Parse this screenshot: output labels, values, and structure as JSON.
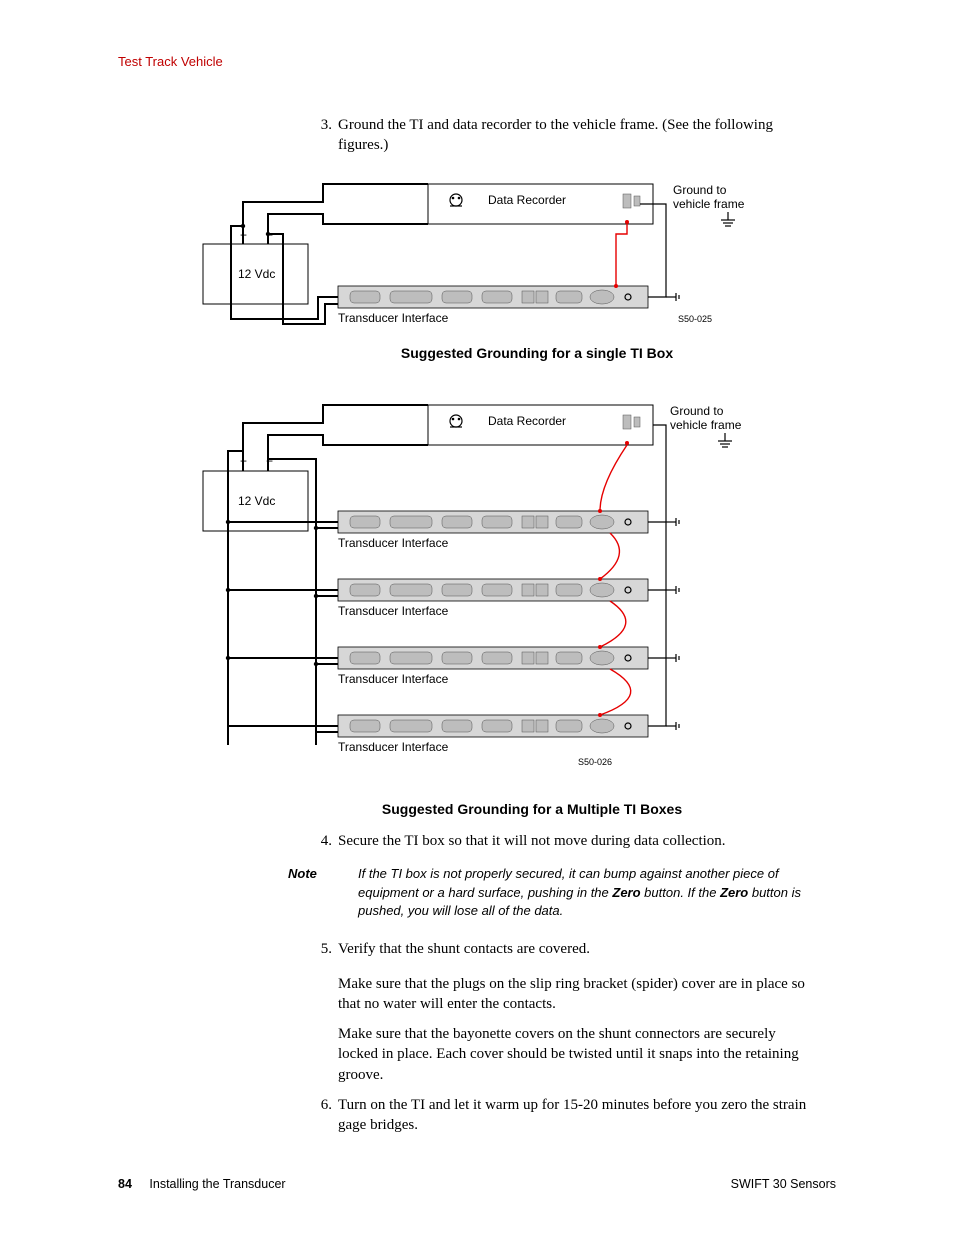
{
  "header": {
    "section": "Test Track Vehicle"
  },
  "steps": {
    "s3": {
      "num": "3.",
      "text": "Ground the TI and data recorder to the vehicle frame. (See the following figures.)"
    },
    "s4": {
      "num": "4.",
      "text": "Secure the TI box so that it will not move during data collection."
    },
    "s5": {
      "num": "5.",
      "text": "Verify that the shunt contacts are covered."
    },
    "s5p1": "Make sure that the plugs on the slip ring bracket (spider) cover are in place so that no water will enter the contacts.",
    "s5p2": "Make sure that the bayonette covers on the shunt connectors are securely locked in place. Each cover should be twisted until it snaps into the retaining groove.",
    "s6": {
      "num": "6.",
      "text": "Turn on the TI and let it warm up for 15-20 minutes before you zero the strain gage bridges."
    }
  },
  "note": {
    "label": "Note",
    "pre": "If the TI box is not properly secured, it can bump against another piece of equipment or a hard surface, pushing in the ",
    "b1": "Zero",
    "mid": " button. If the ",
    "b2": "Zero",
    "post": " button is pushed, you will lose all of the data."
  },
  "diagram1": {
    "caption": "Suggested Grounding for a single TI Box",
    "labels": {
      "data_recorder": "Data Recorder",
      "vdc": "12 Vdc",
      "ti": "Transducer Interface",
      "ground1": "Ground to",
      "ground2": "vehicle frame",
      "figcode": "S50-025",
      "plus": "+",
      "minus": "−"
    }
  },
  "diagram2": {
    "caption": "Suggested Grounding for a Multiple TI Boxes",
    "labels": {
      "data_recorder": "Data Recorder",
      "vdc": "12 Vdc",
      "ti": "Transducer Interface",
      "ground1": "Ground to",
      "ground2": "vehicle frame",
      "figcode": "S50-026",
      "plus": "+",
      "minus": "−"
    }
  },
  "footer": {
    "page": "84",
    "chapter": "Installing the Transducer",
    "doc": "SWIFT 30 Sensors"
  }
}
